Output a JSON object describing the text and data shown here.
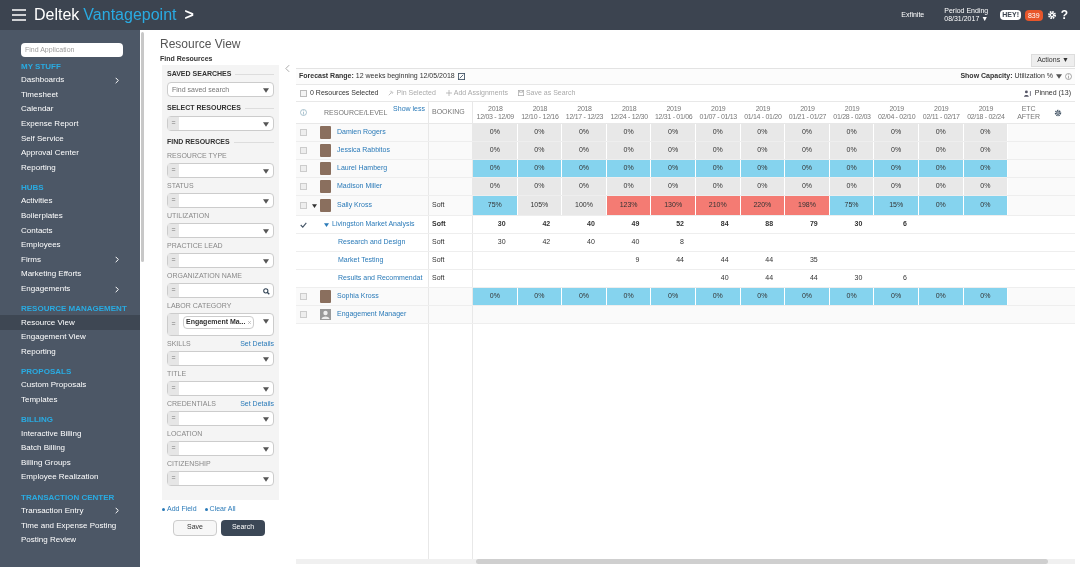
{
  "topbar": {
    "brand": "Deltek",
    "product": "Vantagepoint",
    "chevron": ">",
    "user": "Exfinite",
    "period_label": "Period Ending",
    "period_value": "08/31/2017 ▼",
    "chat_label": "HEY!",
    "notification_count": "839",
    "help": "?"
  },
  "sidebar": {
    "search_placeholder": "Find Application",
    "sections": [
      {
        "title": "MY STUFF",
        "items": [
          {
            "label": "Dashboards",
            "submenu": true,
            "selected": false
          },
          {
            "label": "Timesheet",
            "submenu": false,
            "selected": false
          },
          {
            "label": "Calendar",
            "submenu": false,
            "selected": false
          },
          {
            "label": "Expense Report",
            "submenu": false,
            "selected": false
          },
          {
            "label": "Self Service",
            "submenu": false,
            "selected": false
          },
          {
            "label": "Approval Center",
            "submenu": false,
            "selected": false
          },
          {
            "label": "Reporting",
            "submenu": false,
            "selected": false
          }
        ]
      },
      {
        "title": "HUBS",
        "items": [
          {
            "label": "Activities",
            "submenu": false,
            "selected": false
          },
          {
            "label": "Boilerplates",
            "submenu": false,
            "selected": false
          },
          {
            "label": "Contacts",
            "submenu": false,
            "selected": false
          },
          {
            "label": "Employees",
            "submenu": false,
            "selected": false
          },
          {
            "label": "Firms",
            "submenu": true,
            "selected": false
          },
          {
            "label": "Marketing Efforts",
            "submenu": false,
            "selected": false
          },
          {
            "label": "Engagements",
            "submenu": true,
            "selected": false
          }
        ]
      },
      {
        "title": "RESOURCE MANAGEMENT",
        "items": [
          {
            "label": "Resource View",
            "submenu": false,
            "selected": true
          },
          {
            "label": "Engagement View",
            "submenu": false,
            "selected": false
          },
          {
            "label": "Reporting",
            "submenu": false,
            "selected": false
          }
        ]
      },
      {
        "title": "PROPOSALS",
        "items": [
          {
            "label": "Custom Proposals",
            "submenu": false,
            "selected": false
          },
          {
            "label": "Templates",
            "submenu": false,
            "selected": false
          }
        ]
      },
      {
        "title": "BILLING",
        "items": [
          {
            "label": "Interactive Billing",
            "submenu": false,
            "selected": false
          },
          {
            "label": "Batch Billing",
            "submenu": false,
            "selected": false
          },
          {
            "label": "Billing Groups",
            "submenu": false,
            "selected": false
          },
          {
            "label": "Employee Realization",
            "submenu": false,
            "selected": false
          }
        ]
      },
      {
        "title": "TRANSACTION CENTER",
        "items": [
          {
            "label": "Transaction Entry",
            "submenu": true,
            "selected": false
          },
          {
            "label": "Time and Expense Posting",
            "submenu": false,
            "selected": false
          },
          {
            "label": "Posting Review",
            "submenu": false,
            "selected": false
          }
        ]
      }
    ]
  },
  "page_title": "Resource View",
  "filters": {
    "title": "Find Resources",
    "groups": [
      {
        "heading": "SAVED SEARCHES",
        "fields": [
          {
            "kind": "select",
            "placeholder": "Find saved search"
          }
        ]
      },
      {
        "heading": "SELECT RESOURCES",
        "fields": [
          {
            "kind": "select",
            "operator": "="
          }
        ]
      },
      {
        "heading": "FIND RESOURCES",
        "fields": [
          {
            "kind": "select",
            "label": "RESOURCE TYPE",
            "operator": "="
          },
          {
            "kind": "select",
            "label": "STATUS",
            "operator": "="
          },
          {
            "kind": "select",
            "label": "UTILIZATION",
            "operator": "="
          },
          {
            "kind": "select",
            "label": "PRACTICE LEAD",
            "operator": "="
          },
          {
            "kind": "search",
            "label": "ORGANIZATION NAME",
            "operator": "="
          },
          {
            "kind": "tags",
            "label": "LABOR CATEGORY",
            "operator": "=",
            "tags": [
              "Engagement Ma..."
            ]
          },
          {
            "kind": "select",
            "label": "SKILLS",
            "operator": "=",
            "link": "Set Details"
          },
          {
            "kind": "select",
            "label": "TITLE",
            "operator": "="
          },
          {
            "kind": "select",
            "label": "CREDENTIALS",
            "operator": "=",
            "link": "Set Details"
          },
          {
            "kind": "select",
            "label": "LOCATION",
            "operator": "="
          },
          {
            "kind": "select",
            "label": "CITIZENSHIP",
            "operator": "="
          }
        ]
      }
    ],
    "add_field": "Add Field",
    "clear_all": "Clear All",
    "save": "Save",
    "search": "Search"
  },
  "actions": "Actions ▼",
  "forecast": {
    "label": "Forecast Range:",
    "value": "12 weeks beginning 12/05/2018"
  },
  "capacity": {
    "label": "Show Capacity:",
    "value": "Utilization %"
  },
  "toolbar": {
    "select_all_checked": false,
    "selected_count": "0 Resources Selected",
    "pin": "Pin Selected",
    "add": "Add Assignments",
    "save_search": "Save as Search",
    "pinned": "Pinned (13)"
  },
  "table": {
    "resource_header": "RESOURCE/LEVEL",
    "show_less": "Show less",
    "booking_header": "BOOKING",
    "etc_header": "ETC",
    "after_header": "AFTER",
    "weeks": [
      {
        "year": "2018",
        "range": "12/03 - 12/09"
      },
      {
        "year": "2018",
        "range": "12/10 - 12/16"
      },
      {
        "year": "2018",
        "range": "12/17 - 12/23"
      },
      {
        "year": "2018",
        "range": "12/24 - 12/30"
      },
      {
        "year": "2019",
        "range": "12/31 - 01/06"
      },
      {
        "year": "2019",
        "range": "01/07 - 01/13"
      },
      {
        "year": "2019",
        "range": "01/14 - 01/20"
      },
      {
        "year": "2019",
        "range": "01/21 - 01/27"
      },
      {
        "year": "2019",
        "range": "01/28 - 02/03"
      },
      {
        "year": "2019",
        "range": "02/04 - 02/10"
      },
      {
        "year": "2019",
        "range": "02/11 - 02/17"
      },
      {
        "year": "2019",
        "range": "02/18 - 02/24"
      }
    ],
    "rows": [
      {
        "kind": "resource",
        "name": "Damien Rogers",
        "photo": true,
        "checked": false,
        "cells": [
          {
            "value": "0%",
            "under": false,
            "over": false
          },
          {
            "value": "0%",
            "under": false,
            "over": false
          },
          {
            "value": "0%",
            "under": false,
            "over": false
          },
          {
            "value": "0%",
            "under": false,
            "over": false
          },
          {
            "value": "0%",
            "under": false,
            "over": false
          },
          {
            "value": "0%",
            "under": false,
            "over": false
          },
          {
            "value": "0%",
            "under": false,
            "over": false
          },
          {
            "value": "0%",
            "under": false,
            "over": false
          },
          {
            "value": "0%",
            "under": false,
            "over": false
          },
          {
            "value": "0%",
            "under": false,
            "over": false
          },
          {
            "value": "0%",
            "under": false,
            "over": false
          },
          {
            "value": "0%",
            "under": false,
            "over": false
          }
        ]
      },
      {
        "kind": "resource",
        "name": "Jessica Rabbitos",
        "photo": true,
        "checked": false,
        "cells": [
          {
            "value": "0%",
            "under": false,
            "over": false
          },
          {
            "value": "0%",
            "under": false,
            "over": false
          },
          {
            "value": "0%",
            "under": false,
            "over": false
          },
          {
            "value": "0%",
            "under": false,
            "over": false
          },
          {
            "value": "0%",
            "under": false,
            "over": false
          },
          {
            "value": "0%",
            "under": false,
            "over": false
          },
          {
            "value": "0%",
            "under": false,
            "over": false
          },
          {
            "value": "0%",
            "under": false,
            "over": false
          },
          {
            "value": "0%",
            "under": false,
            "over": false
          },
          {
            "value": "0%",
            "under": false,
            "over": false
          },
          {
            "value": "0%",
            "under": false,
            "over": false
          },
          {
            "value": "0%",
            "under": false,
            "over": false
          }
        ]
      },
      {
        "kind": "resource",
        "name": "Laurel Hamberg",
        "photo": true,
        "checked": false,
        "cells": [
          {
            "value": "0%",
            "under": true,
            "over": false
          },
          {
            "value": "0%",
            "under": true,
            "over": false
          },
          {
            "value": "0%",
            "under": true,
            "over": false
          },
          {
            "value": "0%",
            "under": true,
            "over": false
          },
          {
            "value": "0%",
            "under": true,
            "over": false
          },
          {
            "value": "0%",
            "under": true,
            "over": false
          },
          {
            "value": "0%",
            "under": true,
            "over": false
          },
          {
            "value": "0%",
            "under": true,
            "over": false
          },
          {
            "value": "0%",
            "under": true,
            "over": false
          },
          {
            "value": "0%",
            "under": true,
            "over": false
          },
          {
            "value": "0%",
            "under": true,
            "over": false
          },
          {
            "value": "0%",
            "under": true,
            "over": false
          }
        ]
      },
      {
        "kind": "resource",
        "name": "Madison Miller",
        "photo": true,
        "checked": false,
        "cells": [
          {
            "value": "0%",
            "under": false,
            "over": false
          },
          {
            "value": "0%",
            "under": false,
            "over": false
          },
          {
            "value": "0%",
            "under": false,
            "over": false
          },
          {
            "value": "0%",
            "under": false,
            "over": false
          },
          {
            "value": "0%",
            "under": false,
            "over": false
          },
          {
            "value": "0%",
            "under": false,
            "over": false
          },
          {
            "value": "0%",
            "under": false,
            "over": false
          },
          {
            "value": "0%",
            "under": false,
            "over": false
          },
          {
            "value": "0%",
            "under": false,
            "over": false
          },
          {
            "value": "0%",
            "under": false,
            "over": false
          },
          {
            "value": "0%",
            "under": false,
            "over": false
          },
          {
            "value": "0%",
            "under": false,
            "over": false
          }
        ]
      },
      {
        "kind": "resource",
        "name": "Sally Kross",
        "photo": true,
        "checked": false,
        "expanded": true,
        "booking": "Soft",
        "cells": [
          {
            "value": "75%",
            "under": true,
            "over": false
          },
          {
            "value": "105%",
            "under": false,
            "over": false
          },
          {
            "value": "100%",
            "under": false,
            "over": false
          },
          {
            "value": "123%",
            "under": false,
            "over": true
          },
          {
            "value": "130%",
            "under": false,
            "over": true
          },
          {
            "value": "210%",
            "under": false,
            "over": true
          },
          {
            "value": "220%",
            "under": false,
            "over": true
          },
          {
            "value": "198%",
            "under": false,
            "over": true
          },
          {
            "value": "75%",
            "under": true,
            "over": false
          },
          {
            "value": "15%",
            "under": true,
            "over": false
          },
          {
            "value": "0%",
            "under": true,
            "over": false
          },
          {
            "value": "0%",
            "under": true,
            "over": false
          }
        ],
        "children": [
          {
            "kind": "assignment",
            "name": "Livingston Market Analysis",
            "booking": "Soft",
            "confirmed": true,
            "expanded": true,
            "cells": [
              {
                "kind": "hours",
                "value": "30"
              },
              {
                "kind": "hours",
                "value": "42"
              },
              {
                "kind": "hours",
                "value": "40"
              },
              {
                "kind": "hours",
                "value": "49"
              },
              {
                "kind": "hours",
                "value": "52"
              },
              {
                "kind": "hours",
                "value": "84"
              },
              {
                "kind": "hours",
                "value": "88"
              },
              {
                "kind": "hours",
                "value": "79"
              },
              {
                "kind": "hours",
                "value": "30"
              },
              {
                "kind": "hours",
                "value": "6"
              }
            ],
            "children": [
              {
                "kind": "task",
                "name": "Research and Design",
                "booking": "Soft",
                "confirmed": false,
                "cells": [
                  {
                    "kind": "hours",
                    "value": "30"
                  },
                  {
                    "kind": "hours",
                    "value": "42"
                  },
                  {
                    "kind": "hours",
                    "value": "40"
                  },
                  {
                    "kind": "hours",
                    "value": "40"
                  },
                  {
                    "kind": "hours",
                    "value": "8"
                  }
                ]
              },
              {
                "kind": "task",
                "name": "Market Testing",
                "booking": "Soft",
                "confirmed": false,
                "cells": [
                  {
                    "kind": "blank"
                  },
                  {
                    "kind": "blank"
                  },
                  {
                    "kind": "blank"
                  },
                  {
                    "kind": "hours",
                    "value": "9"
                  },
                  {
                    "kind": "hours",
                    "value": "44"
                  },
                  {
                    "kind": "hours",
                    "value": "44"
                  },
                  {
                    "kind": "hours",
                    "value": "44"
                  },
                  {
                    "kind": "hours",
                    "value": "35"
                  }
                ]
              },
              {
                "kind": "task",
                "name": "Results and Recommendat",
                "booking": "Soft",
                "confirmed": false,
                "cells": [
                  {
                    "kind": "blank"
                  },
                  {
                    "kind": "blank"
                  },
                  {
                    "kind": "blank"
                  },
                  {
                    "kind": "blank"
                  },
                  {
                    "kind": "blank"
                  },
                  {
                    "kind": "hours",
                    "value": "40"
                  },
                  {
                    "kind": "hours",
                    "value": "44"
                  },
                  {
                    "kind": "hours",
                    "value": "44"
                  },
                  {
                    "kind": "hours",
                    "value": "30"
                  },
                  {
                    "kind": "hours",
                    "value": "6"
                  }
                ]
              }
            ]
          }
        ]
      },
      {
        "kind": "resource",
        "name": "Sophia Kross",
        "photo": true,
        "checked": false,
        "cells": [
          {
            "value": "0%",
            "under": true,
            "over": false
          },
          {
            "value": "0%",
            "under": true,
            "over": false
          },
          {
            "value": "0%",
            "under": true,
            "over": false
          },
          {
            "value": "0%",
            "under": true,
            "over": false
          },
          {
            "value": "0%",
            "under": true,
            "over": false
          },
          {
            "value": "0%",
            "under": true,
            "over": false
          },
          {
            "value": "0%",
            "under": true,
            "over": false
          },
          {
            "value": "0%",
            "under": true,
            "over": false
          },
          {
            "value": "0%",
            "under": true,
            "over": false
          },
          {
            "value": "0%",
            "under": true,
            "over": false
          },
          {
            "value": "0%",
            "under": true,
            "over": false
          },
          {
            "value": "0%",
            "under": true,
            "over": false
          }
        ]
      },
      {
        "kind": "resource",
        "name": "Engagement Manager",
        "photo": false,
        "checked": false
      }
    ]
  }
}
